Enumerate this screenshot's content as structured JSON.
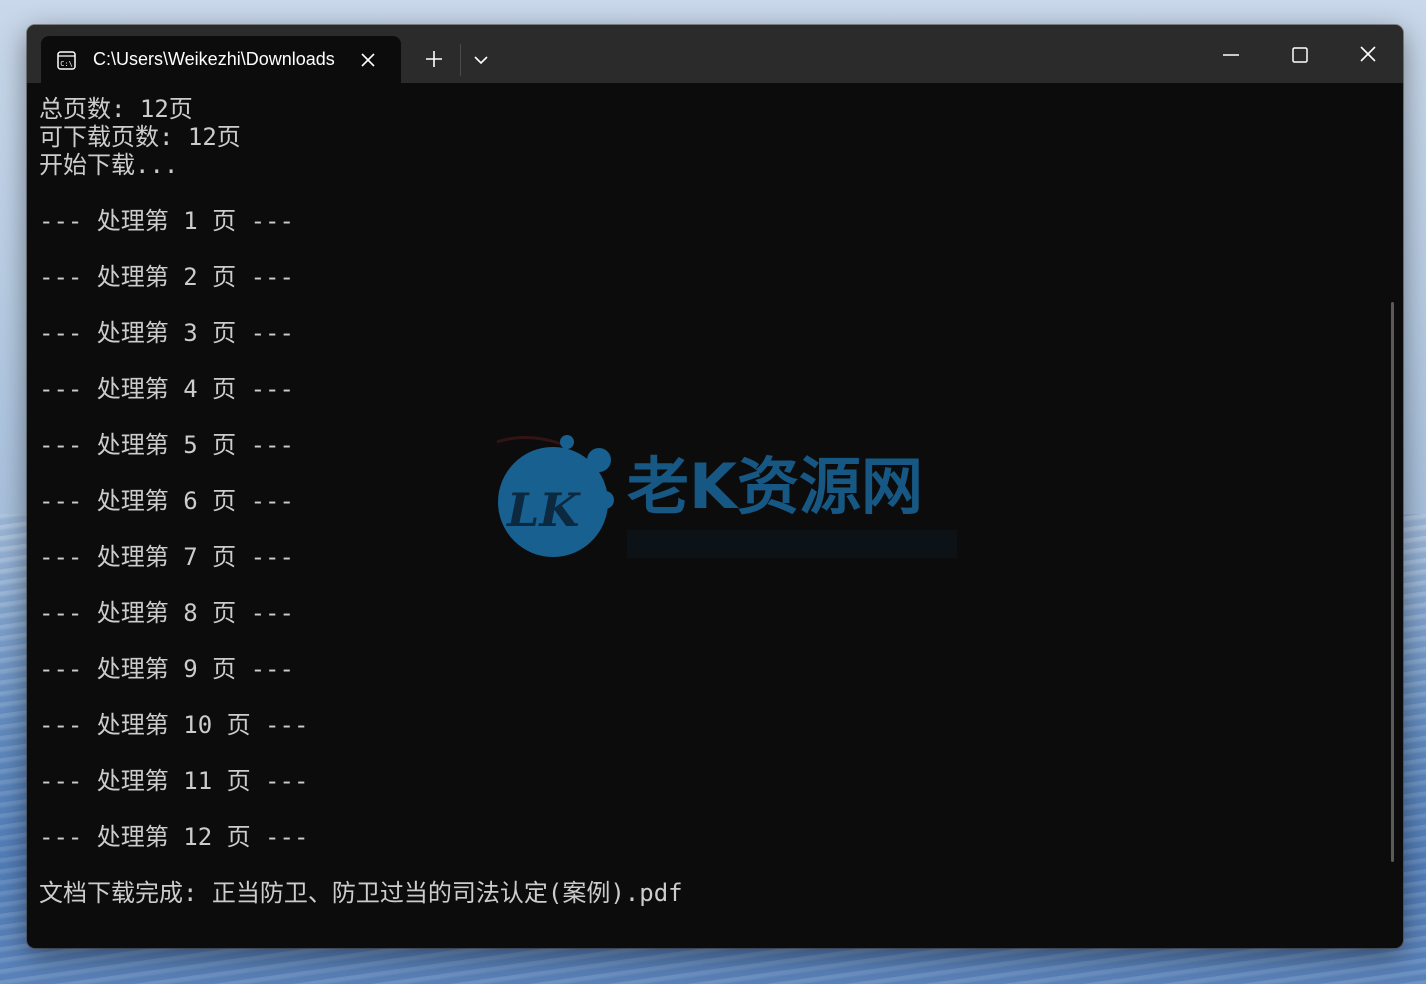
{
  "window": {
    "tab_title": "C:\\Users\\Weikezhi\\Downloads",
    "tab_icon": "terminal-icon"
  },
  "console": {
    "lines": [
      "总页数: 12页",
      "可下载页数: 12页",
      "开始下载...",
      "",
      "--- 处理第 1 页 ---",
      "",
      "--- 处理第 2 页 ---",
      "",
      "--- 处理第 3 页 ---",
      "",
      "--- 处理第 4 页 ---",
      "",
      "--- 处理第 5 页 ---",
      "",
      "--- 处理第 6 页 ---",
      "",
      "--- 处理第 7 页 ---",
      "",
      "--- 处理第 8 页 ---",
      "",
      "--- 处理第 9 页 ---",
      "",
      "--- 处理第 10 页 ---",
      "",
      "--- 处理第 11 页 ---",
      "",
      "--- 处理第 12 页 ---",
      "",
      "文档下载完成: 正当防卫、防卫过当的司法认定(案例).pdf"
    ]
  },
  "watermark": {
    "logo_text": "LK",
    "site_name": "老K资源网"
  },
  "colors": {
    "terminal_bg": "#0c0c0c",
    "titlebar_bg": "#2b2b2b",
    "terminal_text": "#cccccc",
    "watermark_accent": "#1b6fa8"
  }
}
